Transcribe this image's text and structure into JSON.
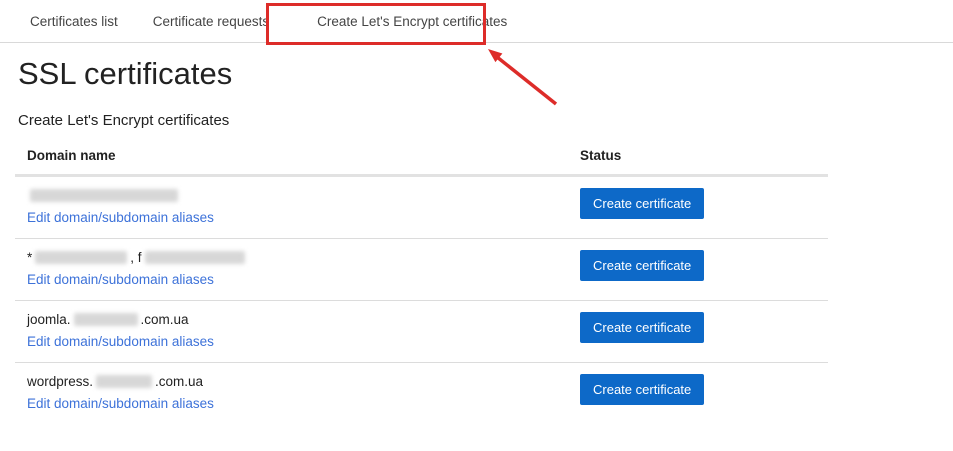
{
  "tabs": [
    {
      "label": "Certificates list"
    },
    {
      "label": "Certificate requests"
    },
    {
      "label": "Create Let's Encrypt certificates"
    }
  ],
  "page": {
    "title": "SSL certificates",
    "subtitle": "Create Let's Encrypt certificates"
  },
  "table": {
    "headers": {
      "domain": "Domain name",
      "status": "Status"
    },
    "edit_link_label": "Edit domain/subdomain aliases",
    "button_label": "Create certificate",
    "rows": [
      {
        "domain_parts": [
          {
            "type": "blur",
            "width": 148
          }
        ]
      },
      {
        "domain_parts": [
          {
            "type": "text",
            "value": "*"
          },
          {
            "type": "blur",
            "width": 92
          },
          {
            "type": "text",
            "value": ", f"
          },
          {
            "type": "blur",
            "width": 100
          }
        ]
      },
      {
        "domain_parts": [
          {
            "type": "text",
            "value": "joomla."
          },
          {
            "type": "blur",
            "width": 64
          },
          {
            "type": "text",
            "value": ".com.ua"
          }
        ]
      },
      {
        "domain_parts": [
          {
            "type": "text",
            "value": "wordpress."
          },
          {
            "type": "blur",
            "width": 56
          },
          {
            "type": "text",
            "value": ".com.ua"
          }
        ]
      }
    ]
  },
  "annotation": {
    "box_color": "#dd2c29",
    "arrow_color": "#dd2c29"
  },
  "colors": {
    "button_blue": "#0d69c8",
    "link_blue": "#3d72d9",
    "annotation_red": "#dd2c29"
  }
}
